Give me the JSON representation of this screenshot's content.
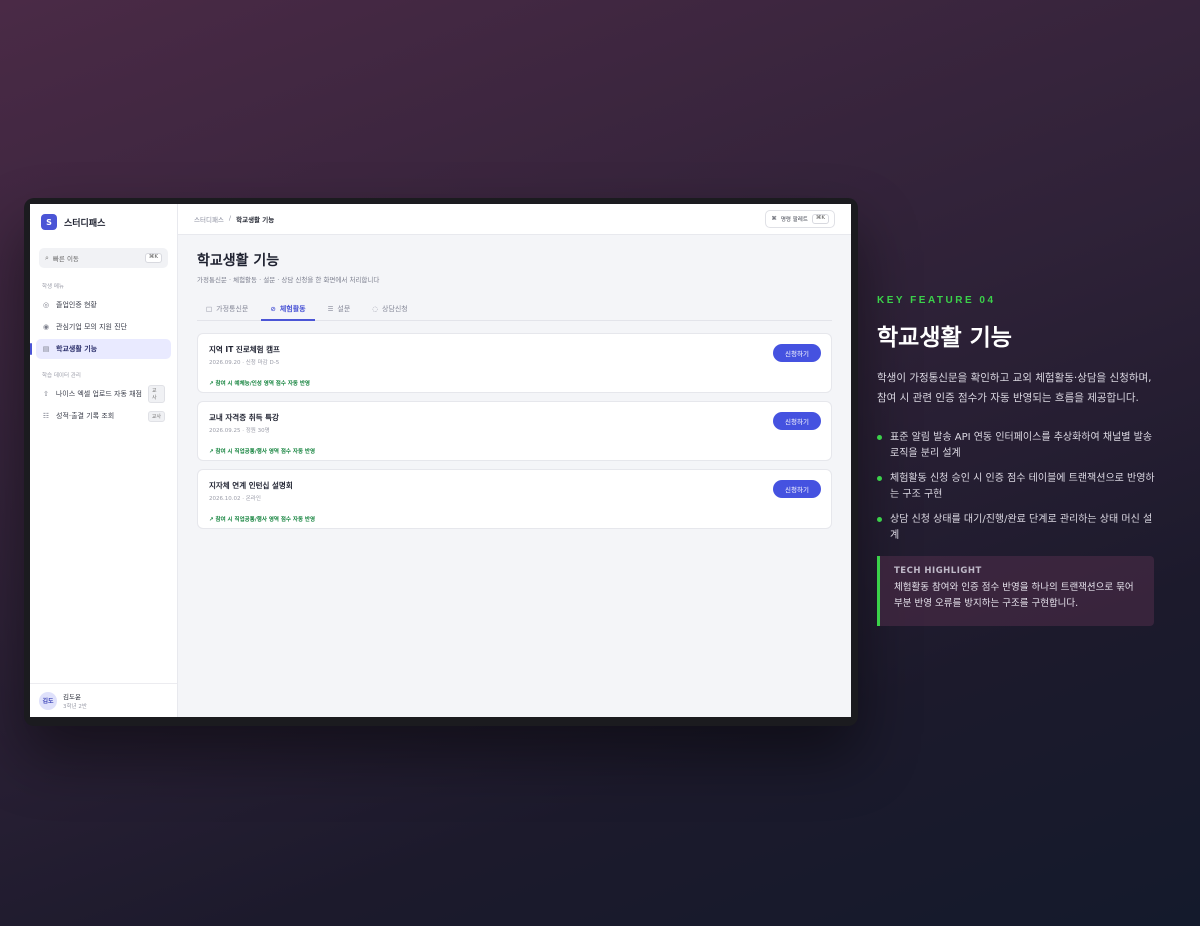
{
  "app": {
    "name": "스터디패스",
    "logo_letter": "S",
    "search": {
      "placeholder": "빠른 이동",
      "shortcut": "⌘K"
    },
    "sidebar": {
      "section1": "학생 메뉴",
      "items1": [
        {
          "icon": "graduation-icon",
          "label": "졸업인증 현황"
        },
        {
          "icon": "target-icon",
          "label": "관심기업 모의 지원 진단"
        },
        {
          "icon": "calendar-icon",
          "label": "학교생활 기능",
          "active": true
        }
      ],
      "section2": "학습 데이터 관리",
      "items2": [
        {
          "icon": "upload-icon",
          "label": "나이스 엑셀 업로드 자동 채점",
          "badge": "교사"
        },
        {
          "icon": "clipboard-icon",
          "label": "성적·출결 기록 조회",
          "badge": "교사"
        }
      ],
      "user": {
        "initials": "김도",
        "name": "김도윤",
        "sub": "3학년 2반"
      }
    },
    "topbar": {
      "crumb_root": "스터디패스",
      "crumb_sep": "/",
      "crumb_current": "학교생활 기능",
      "command_label": "명령 팔레트",
      "command_shortcut": "⌘K"
    },
    "page": {
      "title": "학교생활 기능",
      "subtitle": "가정통신문 · 체험활동 · 설문 · 상담 신청을 한 화면에서 처리합니다",
      "tabs": [
        {
          "label": "가정통신문",
          "icon": "folder-icon"
        },
        {
          "label": "체험활동",
          "icon": "check-circle-icon",
          "active": true
        },
        {
          "label": "설문",
          "icon": "document-icon"
        },
        {
          "label": "상담신청",
          "icon": "chat-icon"
        }
      ],
      "cards": [
        {
          "title": "지역 IT 진로체험 캠프",
          "meta": "2026.09.20 · 신청 마감 D-5",
          "bonus": "↗ 참여 시 예체능/인성 영역 점수 자동 반영",
          "button": "신청하기"
        },
        {
          "title": "교내 자격증 취득 특강",
          "meta": "2026.09.25 · 정원 30명",
          "bonus": "↗ 참여 시 직업공통/행사 영역 점수 자동 반영",
          "button": "신청하기"
        },
        {
          "title": "지자체 연계 인턴십 설명회",
          "meta": "2026.10.02 · 온라인",
          "bonus": "↗ 참여 시 직업공통/행사 영역 점수 자동 반영",
          "button": "신청하기"
        }
      ]
    }
  },
  "feature": {
    "kicker": "KEY FEATURE 04",
    "title": "학교생활 기능",
    "description": "학생이 가정통신문을 확인하고 교외 체험활동·상담을 신청하며, 참여 시 관련 인증 점수가 자동 반영되는 흐름을 제공합니다.",
    "bullets": [
      "표준 알림 발송 API 연동 인터페이스를 추상화하여 채널별 발송 로직을 분리 설계",
      "체험활동 신청 승인 시 인증 점수 테이블에 트랜잭션으로 반영하는 구조 구현",
      "상담 신청 상태를 대기/진행/완료 단계로 관리하는 상태 머신 설계"
    ],
    "tech_label": "TECH HIGHLIGHT",
    "tech_body": "체험활동 참여와 인증 점수 반영을 하나의 트랜잭션으로 묶어 부분 반영 오류를 방지하는 구조를 구현합니다."
  },
  "colors": {
    "accent": "#4b55d6",
    "highlight_green": "#3bd14a",
    "bonus_green": "#16843f"
  }
}
